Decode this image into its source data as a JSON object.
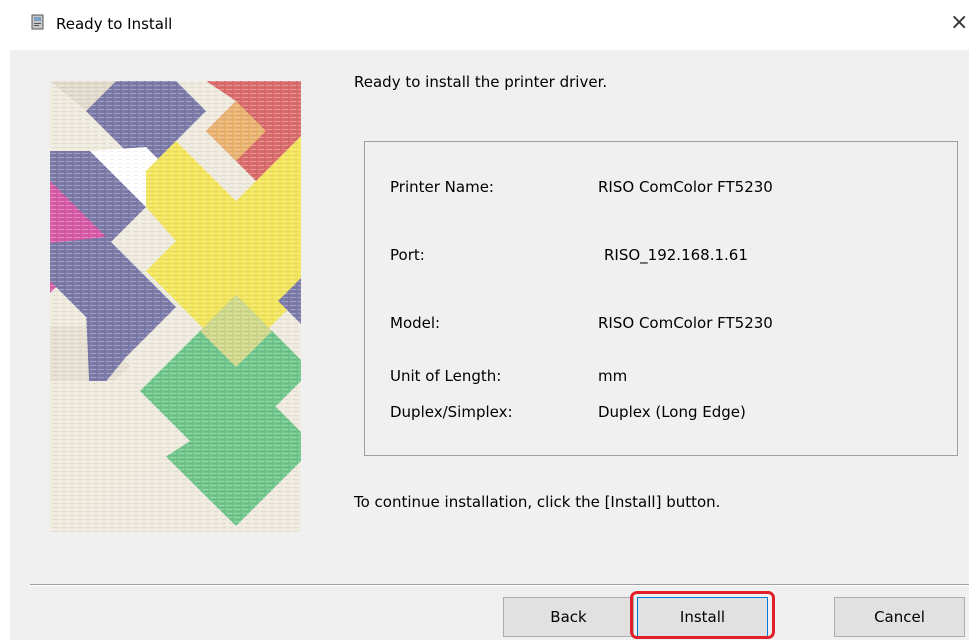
{
  "window": {
    "title": "Ready to Install",
    "icon": "installer-icon",
    "close_icon": "close-icon",
    "close_glyph": "×"
  },
  "main": {
    "heading": "Ready to install the printer driver.",
    "summary": [
      {
        "label": "Printer Name:",
        "value": "RISO ComColor FT5230"
      },
      {
        "label": "Port:",
        "value": "RISO_192.168.1.61"
      },
      {
        "label": "Model:",
        "value": "RISO ComColor FT5230"
      },
      {
        "label": "Unit of Length:",
        "value": "mm"
      },
      {
        "label": "Duplex/Simplex:",
        "value": "Duplex (Long Edge)"
      }
    ],
    "instruction": "To continue installation, click the [Install] button."
  },
  "buttons": {
    "back": "Back",
    "install": "Install",
    "cancel": "Cancel"
  },
  "colors": {
    "highlight": "#e0202a",
    "focus_border": "#0078d7",
    "art_purple": "#7c7aa8",
    "art_red": "#d96b6b",
    "art_yellow": "#f2e55c",
    "art_green": "#6fc58a",
    "art_pink": "#d85aa6",
    "art_orange": "#e8b56a",
    "art_paper": "#eeeade"
  }
}
